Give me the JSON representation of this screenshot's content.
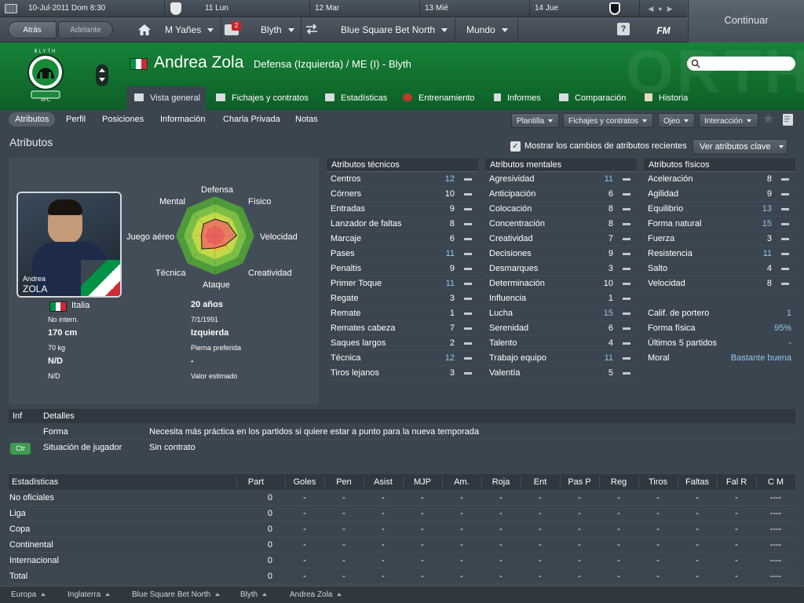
{
  "datebar": {
    "current_date": "10-Jul-2011 Dom 8:30",
    "days": [
      "11 Lun",
      "12 Mar",
      "13 Mié",
      "14 Jue"
    ]
  },
  "nav": {
    "back": "Atrás",
    "forward": "Adelante",
    "manager": "M Yañes",
    "inbox_count": "2",
    "club": "Blyth",
    "league": "Blue Square Bet North",
    "world": "Mundo",
    "help": "?",
    "logo": "FM",
    "continue": "Continuar"
  },
  "header": {
    "bg_text": "ORTH",
    "player_name": "Andrea Zola",
    "player_role": "Defensa (Izquierda) / ME (I) - Blyth",
    "search_placeholder": "",
    "crest": {
      "top_text": "BLYTH",
      "bottom_text": "AFC",
      "brand_colors": [
        "#ffffff",
        "#000000",
        "#1a8a3a"
      ]
    }
  },
  "tabs": [
    {
      "label": "Vista general",
      "icon": "overview-icon"
    },
    {
      "label": "Fichajes y contratos",
      "icon": "contracts-icon"
    },
    {
      "label": "Estadísticas",
      "icon": "stats-icon"
    },
    {
      "label": "Entrenamiento",
      "icon": "training-icon"
    },
    {
      "label": "Informes",
      "icon": "reports-icon"
    },
    {
      "label": "Comparación",
      "icon": "compare-icon"
    },
    {
      "label": "Historia",
      "icon": "history-icon"
    }
  ],
  "subnav": {
    "items": [
      "Atributos",
      "Perfil",
      "Posiciones",
      "Información",
      "Charla Privada",
      "Notas"
    ],
    "dropdowns": [
      "Plantilla",
      "Fichajes y contratos",
      "Ojeo",
      "Interacción"
    ]
  },
  "attributes_title": "Atributos",
  "show_changes_label": "Mostrar los cambios de atributos recientes",
  "show_changes_checked": true,
  "key_attributes_button": "Ver atributos clave",
  "profile": {
    "photo_first_name": "Andrea",
    "photo_last_name": "ZOLA",
    "radar_labels": {
      "defensa": "Defensa",
      "fisico": "Físico",
      "velocidad": "Velocidad",
      "creatividad": "Creatividad",
      "ataque": "Ataque",
      "tecnica": "Técnica",
      "juego_aereo": "Juego aéreo",
      "mental": "Mental"
    },
    "radar_values": {
      "defensa": 0.42,
      "fisico": 0.45,
      "velocidad": 0.55,
      "creatividad": 0.35,
      "ataque": 0.32,
      "tecnica": 0.48,
      "juego_aereo": 0.35,
      "mental": 0.42
    },
    "info_left": [
      "Italia",
      "No intern.",
      "170 cm",
      "70 kg",
      "N/D",
      "N/D"
    ],
    "info_right": [
      "20 años",
      "7/1/1991",
      "Izquierda",
      "Pierna preferida",
      "-",
      "Valor estimado"
    ]
  },
  "technical": {
    "title": "Atributos técnicos",
    "rows": [
      {
        "name": "Centros",
        "value": "12",
        "hi": true
      },
      {
        "name": "Córners",
        "value": "10",
        "hi": false
      },
      {
        "name": "Entradas",
        "value": "9",
        "hi": false
      },
      {
        "name": "Lanzador de faltas",
        "value": "8",
        "hi": false
      },
      {
        "name": "Marcaje",
        "value": "6",
        "hi": false
      },
      {
        "name": "Pases",
        "value": "11",
        "hi": true
      },
      {
        "name": "Penaltis",
        "value": "9",
        "hi": false
      },
      {
        "name": "Primer Toque",
        "value": "11",
        "hi": true
      },
      {
        "name": "Regate",
        "value": "3",
        "hi": false
      },
      {
        "name": "Remate",
        "value": "1",
        "hi": false
      },
      {
        "name": "Remates cabeza",
        "value": "7",
        "hi": false
      },
      {
        "name": "Saques largos",
        "value": "2",
        "hi": false
      },
      {
        "name": "Técnica",
        "value": "12",
        "hi": true
      },
      {
        "name": "Tiros lejanos",
        "value": "3",
        "hi": false
      }
    ]
  },
  "mental": {
    "title": "Atributos mentales",
    "rows": [
      {
        "name": "Agresividad",
        "value": "11",
        "hi": true
      },
      {
        "name": "Anticipación",
        "value": "6",
        "hi": false
      },
      {
        "name": "Colocación",
        "value": "8",
        "hi": false
      },
      {
        "name": "Concentración",
        "value": "8",
        "hi": false
      },
      {
        "name": "Creatividad",
        "value": "7",
        "hi": false
      },
      {
        "name": "Decisiones",
        "value": "9",
        "hi": false
      },
      {
        "name": "Desmarques",
        "value": "3",
        "hi": false
      },
      {
        "name": "Determinación",
        "value": "10",
        "hi": false
      },
      {
        "name": "Influencia",
        "value": "1",
        "hi": false
      },
      {
        "name": "Lucha",
        "value": "15",
        "hi": true
      },
      {
        "name": "Serenidad",
        "value": "6",
        "hi": false
      },
      {
        "name": "Talento",
        "value": "4",
        "hi": false
      },
      {
        "name": "Trabajo equipo",
        "value": "11",
        "hi": true
      },
      {
        "name": "Valentía",
        "value": "5",
        "hi": false
      }
    ]
  },
  "physical": {
    "title": "Atributos físicos",
    "rows": [
      {
        "name": "Aceleración",
        "value": "8",
        "hi": false
      },
      {
        "name": "Agilidad",
        "value": "9",
        "hi": false
      },
      {
        "name": "Equilibrio",
        "value": "13",
        "hi": true
      },
      {
        "name": "Forma natural",
        "value": "15",
        "hi": true
      },
      {
        "name": "Fuerza",
        "value": "3",
        "hi": false
      },
      {
        "name": "Resistencia",
        "value": "11",
        "hi": true
      },
      {
        "name": "Salto",
        "value": "4",
        "hi": false
      },
      {
        "name": "Velocidad",
        "value": "8",
        "hi": false
      }
    ],
    "extras": [
      {
        "name": "Calif. de portero",
        "value": "1"
      },
      {
        "name": "Forma física",
        "value": "95%"
      },
      {
        "name": "Últimos 5 partidos",
        "value": "-"
      },
      {
        "name": "Moral",
        "value": "Bastante buena"
      }
    ]
  },
  "details": {
    "col_inf": "Inf",
    "col_detalles": "Detalles",
    "rows": [
      {
        "badge": "",
        "label": "Forma",
        "text": "Necesita más práctica en los partidos si quiere estar a punto para la nueva temporada"
      },
      {
        "badge": "Ctr",
        "label": "Situación de jugador",
        "text": "Sin contrato"
      }
    ]
  },
  "stats": {
    "headers": [
      "Estadísticas",
      "Part",
      "Goles",
      "Pen",
      "Asist",
      "MJP",
      "Am.",
      "Roja",
      "Ent",
      "Pas P",
      "Reg",
      "Tiros",
      "Faltas",
      "Fal R",
      "C M"
    ],
    "rows": [
      [
        "No oficiales",
        "0",
        "-",
        "-",
        "-",
        "-",
        "-",
        "-",
        "-",
        "-",
        "-",
        "-",
        "-",
        "-",
        "----"
      ],
      [
        "Liga",
        "0",
        "-",
        "-",
        "-",
        "-",
        "-",
        "-",
        "-",
        "-",
        "-",
        "-",
        "-",
        "-",
        "----"
      ],
      [
        "Copa",
        "0",
        "-",
        "-",
        "-",
        "-",
        "-",
        "-",
        "-",
        "-",
        "-",
        "-",
        "-",
        "-",
        "----"
      ],
      [
        "Continental",
        "0",
        "-",
        "-",
        "-",
        "-",
        "-",
        "-",
        "-",
        "-",
        "-",
        "-",
        "-",
        "-",
        "----"
      ],
      [
        "Internacional",
        "0",
        "-",
        "-",
        "-",
        "-",
        "-",
        "-",
        "-",
        "-",
        "-",
        "-",
        "-",
        "-",
        "----"
      ],
      [
        "Total",
        "0",
        "-",
        "-",
        "-",
        "-",
        "-",
        "-",
        "-",
        "-",
        "-",
        "-",
        "-",
        "-",
        "----"
      ]
    ]
  },
  "breadcrumbs": [
    "Europa",
    "Inglaterra",
    "Blue Square Bet North",
    "Blyth",
    "Andrea Zola"
  ],
  "colors": {
    "accent_green": "#178338",
    "highlight_value": "#8ec8ec",
    "panel": "#434d58",
    "background": "#3b4550"
  }
}
